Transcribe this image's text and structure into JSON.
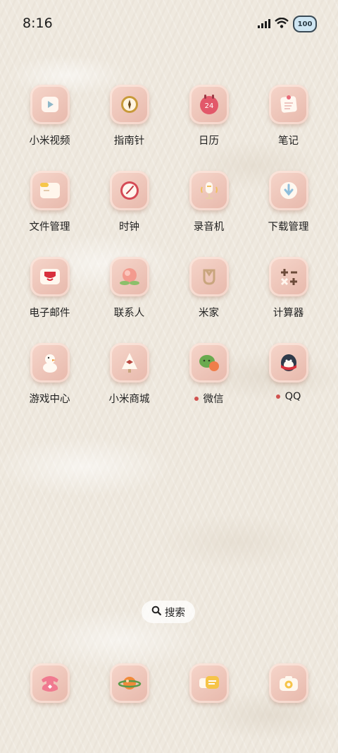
{
  "status_bar": {
    "time": "8:16",
    "battery": "100"
  },
  "apps": [
    {
      "label": "小米视频",
      "icon": "video-play-icon",
      "badge": false
    },
    {
      "label": "指南针",
      "icon": "compass-icon",
      "badge": false
    },
    {
      "label": "日历",
      "icon": "calendar-icon",
      "badge": false,
      "icon_text": "24"
    },
    {
      "label": "笔记",
      "icon": "notes-icon",
      "badge": false
    },
    {
      "label": "文件管理",
      "icon": "folder-icon",
      "badge": false
    },
    {
      "label": "时钟",
      "icon": "clock-icon",
      "badge": false
    },
    {
      "label": "录音机",
      "icon": "microphone-icon",
      "badge": false
    },
    {
      "label": "下载管理",
      "icon": "download-icon",
      "badge": false
    },
    {
      "label": "电子邮件",
      "icon": "mail-icon",
      "badge": false
    },
    {
      "label": "联系人",
      "icon": "peach-contact-icon",
      "badge": false
    },
    {
      "label": "米家",
      "icon": "mijia-icon",
      "badge": false
    },
    {
      "label": "计算器",
      "icon": "calculator-icon",
      "badge": false
    },
    {
      "label": "游戏中心",
      "icon": "game-duck-icon",
      "badge": false
    },
    {
      "label": "小米商城",
      "icon": "shop-tree-icon",
      "badge": false
    },
    {
      "label": "微信",
      "icon": "wechat-icon",
      "badge": true
    },
    {
      "label": "QQ",
      "icon": "qq-penguin-icon",
      "badge": true
    }
  ],
  "search": {
    "label": "搜索"
  },
  "dock": [
    {
      "icon": "phone-icon"
    },
    {
      "icon": "browser-planet-icon"
    },
    {
      "icon": "messages-icon"
    },
    {
      "icon": "camera-icon"
    }
  ]
}
